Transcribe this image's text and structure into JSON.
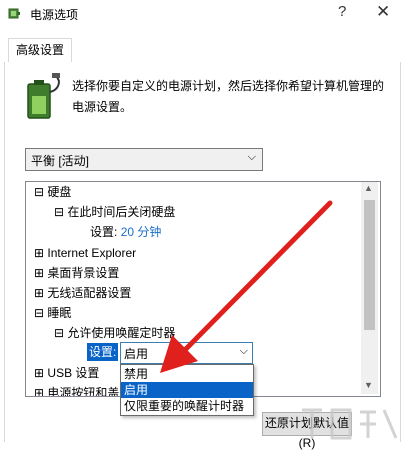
{
  "window": {
    "title": "电源选项",
    "help_glyph": "?",
    "close_glyph": "✕"
  },
  "tabs": [
    {
      "label": "高级设置"
    }
  ],
  "description": "选择你要自定义的电源计划，然后选择你希望计算机管理的电源设置。",
  "plan_select": {
    "value": "平衡 [活动]"
  },
  "tree": {
    "items": [
      {
        "expander": "⊟",
        "label": "硬盘"
      },
      {
        "expander": "⊟",
        "label": "在此时间后关闭硬盘"
      },
      {
        "prefix": "设置:",
        "value": "20 分钟"
      },
      {
        "expander": "⊞",
        "label": "Internet Explorer"
      },
      {
        "expander": "⊞",
        "label": "桌面背景设置"
      },
      {
        "expander": "⊞",
        "label": "无线适配器设置"
      },
      {
        "expander": "⊟",
        "label": "睡眠"
      },
      {
        "expander": "⊟",
        "label": "允许使用唤醒定时器"
      },
      {
        "expander": "⊞",
        "label": "USB 设置"
      },
      {
        "expander": "⊞",
        "label": "电源按钮和盖"
      }
    ],
    "setting": {
      "label": "设置:",
      "selected": "启用"
    },
    "dropdown_options": [
      "禁用",
      "启用",
      "仅限重要的唤醒计时器"
    ]
  },
  "buttons": {
    "restore": "还原计划默认值(R)"
  },
  "colors": {
    "selection": "#0a64c8",
    "link": "#1a6fc9",
    "arrow": "#e0201c"
  }
}
